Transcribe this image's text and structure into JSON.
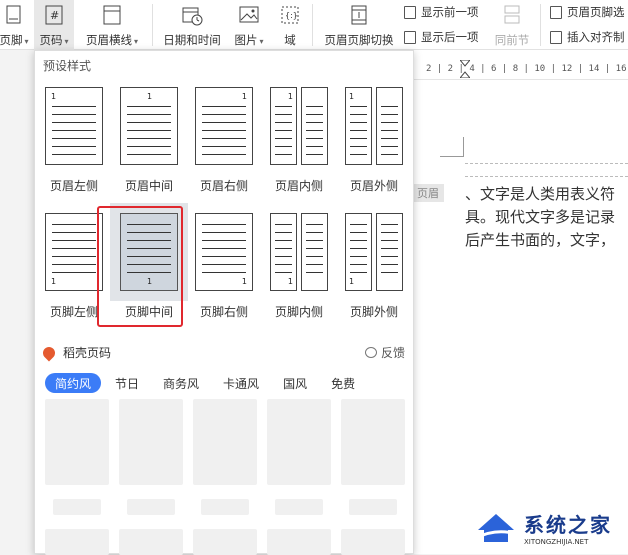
{
  "ribbon": {
    "items": [
      {
        "label": "页脚",
        "caret": "▾"
      },
      {
        "label": "页码",
        "caret": "▾"
      },
      {
        "label": "页眉横线",
        "caret": "▾"
      },
      {
        "label": "日期和时间",
        "caret": ""
      },
      {
        "label": "图片",
        "caret": "▾"
      },
      {
        "label": "域",
        "caret": ""
      },
      {
        "label": "页眉页脚切换",
        "caret": ""
      }
    ],
    "show_prev": "显示前一项",
    "show_next": "显示后一项",
    "same_prev": "同前节",
    "header_footer_opts": "页眉页脚选",
    "insert_align": "插入对齐制"
  },
  "ruler": {
    "marks": "2 | 2 | 4 | 6 | 8 | 10 | 12 | 14 | 16 |"
  },
  "panel": {
    "preset_title": "预设样式",
    "header_styles": [
      {
        "label": "页眉左侧",
        "num": "1"
      },
      {
        "label": "页眉中间",
        "num": "1"
      },
      {
        "label": "页眉右侧",
        "num": "1"
      },
      {
        "label": "页眉内侧",
        "num": "1"
      },
      {
        "label": "页眉外侧",
        "num": "1"
      }
    ],
    "footer_styles": [
      {
        "label": "页脚左侧",
        "num": "1"
      },
      {
        "label": "页脚中间",
        "num": "1"
      },
      {
        "label": "页脚右侧",
        "num": "1"
      },
      {
        "label": "页脚内侧",
        "num": "1"
      },
      {
        "label": "页脚外侧",
        "num": "1"
      }
    ],
    "selected": "页脚中间",
    "brand": "稻壳页码",
    "feedback": "反馈",
    "tabs": [
      "简约风",
      "节日",
      "商务风",
      "卡通风",
      "国风",
      "免费"
    ],
    "active_tab": "简约风"
  },
  "document": {
    "header_tag": "页眉",
    "lines": [
      "、文字是人类用表义符",
      "具。现代文字多是记录",
      "后产生书面的，文字，"
    ]
  },
  "watermark": {
    "main": "系统之家",
    "sub": "XITONGZHIJIA.NET"
  },
  "colors": {
    "accent": "#3b7cf7",
    "highlight": "#e0282e",
    "brand": "#e55a2f"
  }
}
